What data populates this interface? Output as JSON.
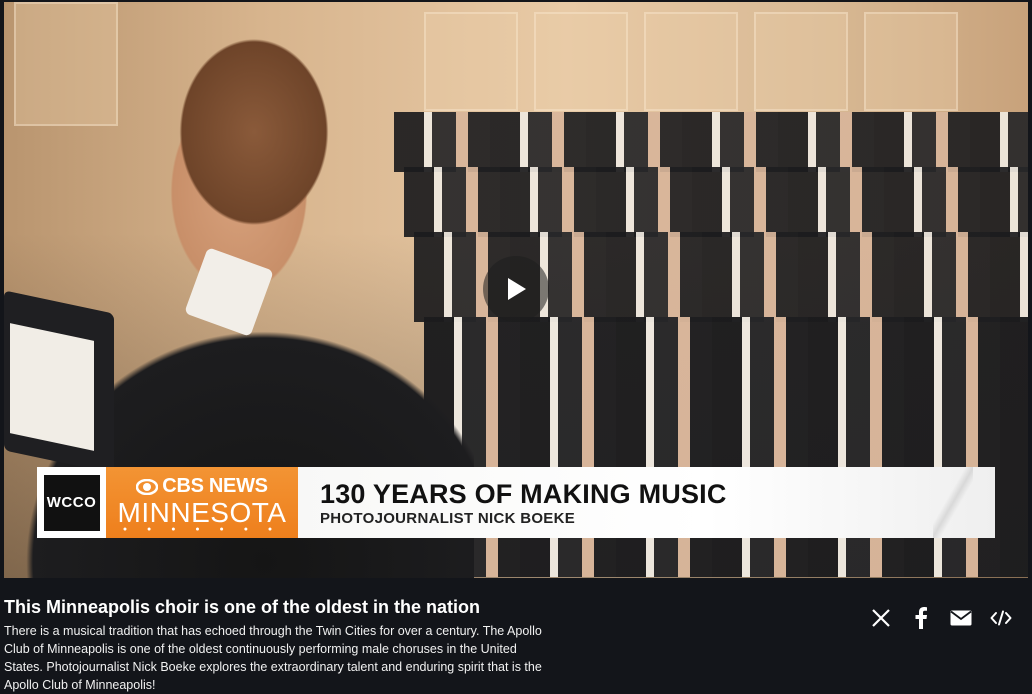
{
  "video": {
    "lower_third": {
      "station": "WCCO",
      "network_top": "CBS NEWS",
      "network_bottom": "MINNESOTA",
      "headline": "130 YEARS OF MAKING MUSIC",
      "subhead": "PHOTOJOURNALIST NICK BOEKE"
    },
    "play_icon": "play-icon"
  },
  "article": {
    "title": "This Minneapolis choir is one of the oldest in the nation",
    "description": "There is a musical tradition that has echoed through the Twin Cities for over a century. The Apollo Club of Minneapolis is one of the oldest continuously performing male choruses in the United States. Photojournalist Nick Boeke explores the extraordinary talent and enduring spirit that is the Apollo Club of Minneapolis!"
  },
  "share": {
    "icons": [
      "x-icon",
      "facebook-icon",
      "email-icon",
      "embed-icon"
    ]
  },
  "colors": {
    "background": "#13151a",
    "brand_orange": "#ee7f1c"
  }
}
